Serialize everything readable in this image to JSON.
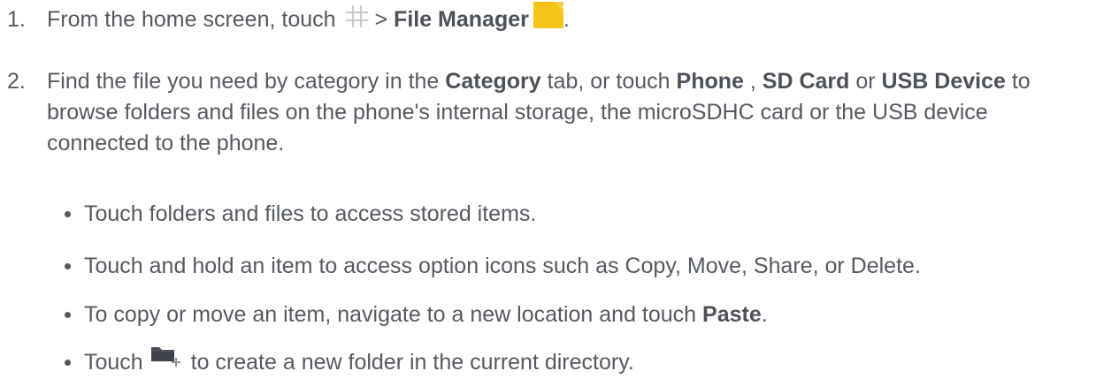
{
  "step1": {
    "number": "1.",
    "text_before": "From the home screen, touch",
    "apps_icon": "apps-grid-icon",
    "separator": ">",
    "file_manager": "File Manager",
    "file_manager_icon": "file-manager-icon",
    "period": "."
  },
  "step2": {
    "number": "2.",
    "t1": "Find the file you need by category in the ",
    "category": "Category",
    "t2": " tab, or touch ",
    "phone": "Phone",
    "t3": " , ",
    "sd_card": "SD Card",
    "t4": " or ",
    "usb_device": "USB Device",
    "t5": " to browse folders and files on the phone's internal storage, the microSDHC card or the USB device connected to the phone."
  },
  "bullets": {
    "b1": "Touch folders and files to access stored items.",
    "b2": "Touch and hold an item to access option icons such as Copy, Move, Share, or Delete.",
    "b3_pre": "To copy or move an item, navigate to a new location and touch ",
    "b3_bold": "Paste",
    "b3_post": ".",
    "b4_pre": "Touch",
    "b4_icon": "new-folder-icon",
    "b4_post": "to create a new folder in the current directory."
  },
  "colors": {
    "text": "#555a60",
    "icon_yellow": "#f6c51a",
    "icon_grey": "#4a4f57",
    "grid_grey": "#c8c8c8"
  }
}
